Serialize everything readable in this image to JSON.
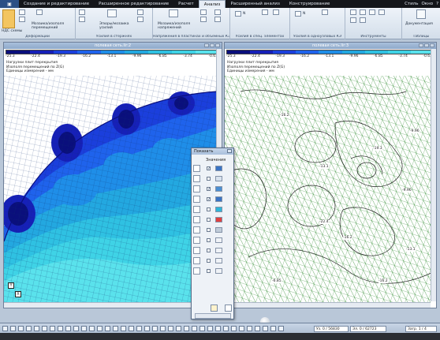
{
  "ribbon": {
    "tabs": [
      "Создание и редактирование",
      "Расширенное редактирование",
      "Расчет",
      "Анализ",
      "Расширенный анализ",
      "Конструирование"
    ],
    "active_tab": "Анализ",
    "right_controls": [
      "Стиль",
      "Окно",
      "?"
    ],
    "groups": [
      {
        "label": "Деформации",
        "buttons": [
          "НДС схемы",
          "Мозаика/изополя перемещений"
        ]
      },
      {
        "label": "Усилия в стержнях",
        "buttons": [
          "Эпюры/мозаика усилий"
        ]
      },
      {
        "label": "Напряжения в пластинах и объемных КЭ",
        "buttons": [
          "Мозаика/изополя напряжений"
        ]
      },
      {
        "label": "Усилия в спец. элементах",
        "buttons": [
          "N"
        ]
      },
      {
        "label": "Усилия в одноузловых КЭ",
        "buttons": [
          "N"
        ]
      },
      {
        "label": "Инструменты",
        "buttons": []
      },
      {
        "label": "Таблицы",
        "buttons": [
          "Документация"
        ]
      }
    ]
  },
  "left_window": {
    "title": "полевая сеть.lir:2",
    "scale_values": [
      "-25.3",
      "-22.4",
      "-19.3",
      "-16.2",
      "-13.1",
      "-9.96",
      "-6.85",
      "-3.74",
      "-0.637"
    ],
    "legend_lines": [
      "Нагрузки плит перекрытия",
      "Изополя перемещений по Z(G)",
      "Единицы измерения - мм"
    ]
  },
  "right_window": {
    "title": "полевая сеть.lir:3",
    "scale_values": [
      "-25.3",
      "-22.4",
      "-19.3",
      "-16.2",
      "-13.1",
      "-9.96",
      "-6.85",
      "-3.74",
      "-0.637"
    ],
    "legend_lines": [
      "Нагрузки плит перекрытия",
      "Изополя перемещений по Z(G)",
      "Единицы измерения - мм"
    ],
    "contour_labels": [
      "-16.2",
      "-19.3",
      "-13.1",
      "-9.96",
      "-16.2",
      "-22.4",
      "-13.1",
      "-6.85",
      "-16.2",
      "-9.96"
    ]
  },
  "dialog": {
    "title": "Показать",
    "header": "Значения"
  },
  "status": {
    "fields": [
      "Уз. 0 / 56830",
      "Эл. 0 / 62723",
      "Загр. 1 / 4"
    ]
  },
  "axis": {
    "y": "Y",
    "x": "X"
  },
  "colors": {
    "scale": [
      "#0a0f7c",
      "#1620b8",
      "#1b3fdc",
      "#1f63ec",
      "#1f8ee8",
      "#23a8e0",
      "#2fc1e2",
      "#3fd3e6",
      "#5ae2ec"
    ],
    "mesh_green": "#2c8a2c"
  }
}
